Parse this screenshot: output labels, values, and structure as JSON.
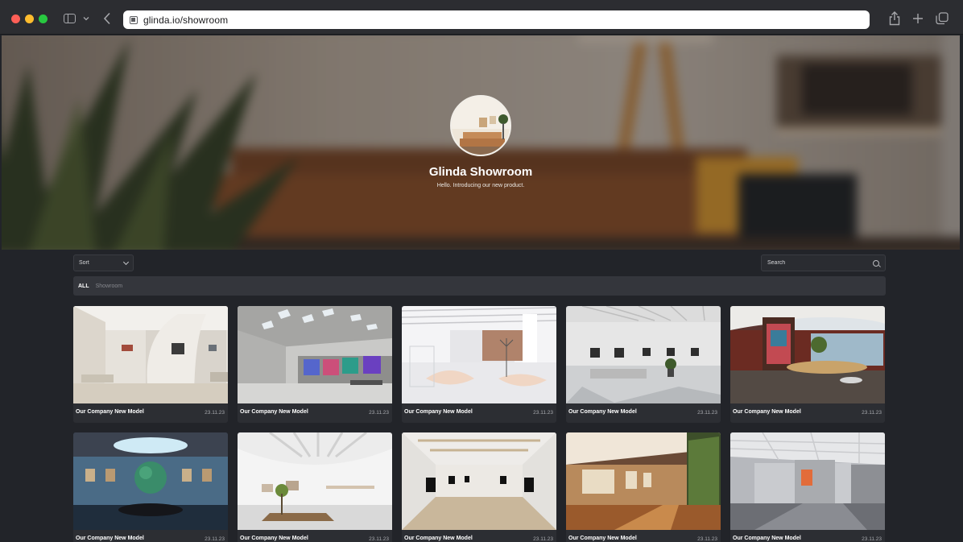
{
  "browser": {
    "url": "glinda.io/showroom"
  },
  "hero": {
    "title": "Glinda Showroom",
    "subtitle": "Hello. Introducing our new product."
  },
  "controls": {
    "sort_label": "Sort",
    "search_placeholder": "Search"
  },
  "filters": [
    {
      "label": "ALL",
      "active": true
    },
    {
      "label": "Showroom",
      "active": false
    }
  ],
  "cards": [
    {
      "title": "Our Company New Model",
      "date": "23.11.23",
      "scene": "white-curved-gallery"
    },
    {
      "title": "Our Company New Model",
      "date": "23.11.23",
      "scene": "geometric-ceiling-hall"
    },
    {
      "title": "Our Company New Model",
      "date": "23.11.23",
      "scene": "white-lounge"
    },
    {
      "title": "Our Company New Model",
      "date": "23.11.23",
      "scene": "marble-gallery"
    },
    {
      "title": "Our Company New Model",
      "date": "23.11.23",
      "scene": "circular-skylight-hall"
    },
    {
      "title": "Our Company New Model",
      "date": "23.11.23",
      "scene": "globe-gallery"
    },
    {
      "title": "Our Company New Model",
      "date": "23.11.23",
      "scene": "white-lobby"
    },
    {
      "title": "Our Company New Model",
      "date": "23.11.23",
      "scene": "long-corridor-gallery"
    },
    {
      "title": "Our Company New Model",
      "date": "23.11.23",
      "scene": "wood-corridor"
    },
    {
      "title": "Our Company New Model",
      "date": "23.11.23",
      "scene": "grey-gallery"
    }
  ],
  "colors": {
    "background": "#222429",
    "card": "#2c2e33",
    "filter_bar": "#34363c",
    "url_bar": "#ffffff"
  }
}
